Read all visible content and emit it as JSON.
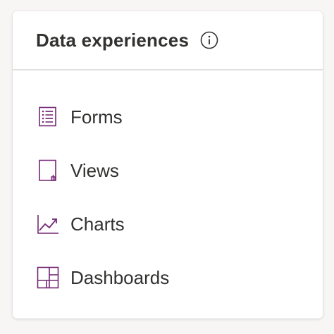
{
  "panel": {
    "title": "Data experiences",
    "info_icon": "info-icon",
    "accent_color": "#742774",
    "items": [
      {
        "label": "Forms",
        "icon": "form-list-icon"
      },
      {
        "label": "Views",
        "icon": "view-page-icon"
      },
      {
        "label": "Charts",
        "icon": "line-chart-icon"
      },
      {
        "label": "Dashboards",
        "icon": "dashboard-grid-icon"
      }
    ]
  }
}
